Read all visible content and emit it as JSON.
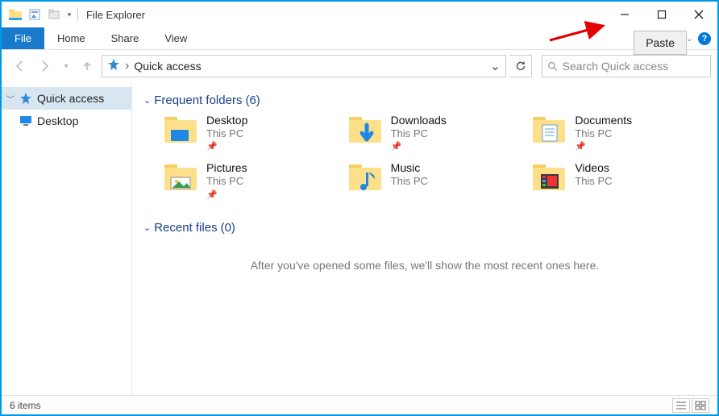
{
  "window": {
    "title": "File Explorer"
  },
  "ribbon": {
    "file": "File",
    "home": "Home",
    "share": "Share",
    "view": "View"
  },
  "tooltip": {
    "paste": "Paste"
  },
  "address": {
    "location": "Quick access",
    "separator": "›"
  },
  "search": {
    "placeholder": "Search Quick access"
  },
  "sidebar": {
    "quick_access": "Quick access",
    "desktop": "Desktop"
  },
  "groups": {
    "frequent": {
      "label": "Frequent folders",
      "count_label": "(6)"
    },
    "recent": {
      "label": "Recent files",
      "count_label": "(0)"
    }
  },
  "folders": [
    {
      "name": "Desktop",
      "location": "This PC",
      "pinned": true,
      "kind": "desktop"
    },
    {
      "name": "Downloads",
      "location": "This PC",
      "pinned": true,
      "kind": "downloads"
    },
    {
      "name": "Documents",
      "location": "This PC",
      "pinned": true,
      "kind": "documents"
    },
    {
      "name": "Pictures",
      "location": "This PC",
      "pinned": true,
      "kind": "pictures"
    },
    {
      "name": "Music",
      "location": "This PC",
      "pinned": false,
      "kind": "music"
    },
    {
      "name": "Videos",
      "location": "This PC",
      "pinned": false,
      "kind": "videos"
    }
  ],
  "recent_empty_msg": "After you've opened some files, we'll show the most recent ones here.",
  "status": {
    "item_count": "6 items"
  }
}
